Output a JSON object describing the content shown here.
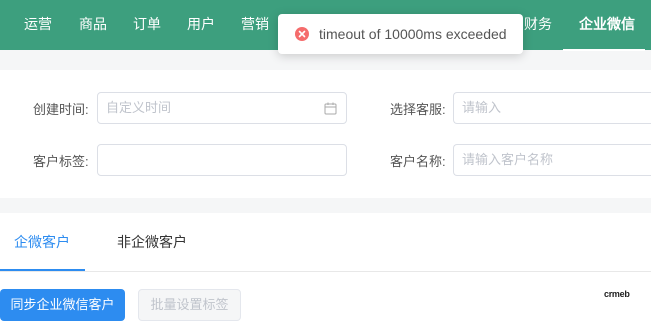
{
  "nav": {
    "items": [
      {
        "label": "运营",
        "key": "yunying"
      },
      {
        "label": "商品",
        "key": "shangpin"
      },
      {
        "label": "订单",
        "key": "dingdan"
      },
      {
        "label": "用户",
        "key": "yonghu"
      },
      {
        "label": "营销",
        "key": "yingxiao"
      },
      {
        "label": "财务",
        "key": "caiwu"
      },
      {
        "label": "企业微信",
        "key": "qiyeweixin",
        "active": true
      }
    ],
    "background": "#3d9f7e"
  },
  "toast": {
    "message": "timeout of 10000ms exceeded",
    "type": "error",
    "icon": "error-circle-icon",
    "color": "#f56c6c"
  },
  "filters": {
    "created_time": {
      "label": "创建时间:",
      "placeholder": "自定义时间",
      "icon": "calendar-icon"
    },
    "service_agent": {
      "label": "选择客服:",
      "placeholder": "请输入"
    },
    "customer_tag": {
      "label": "客户标签:",
      "value": ""
    },
    "customer_name": {
      "label": "客户名称:",
      "placeholder": "请输入客户名称"
    }
  },
  "tabs": [
    {
      "label": "企微客户",
      "active": true
    },
    {
      "label": "非企微客户",
      "active": false
    }
  ],
  "actions": {
    "sync_label": "同步企业微信客户",
    "batch_tag_label": "批量设置标签"
  },
  "brand": {
    "logo_text": "crmeb"
  },
  "colors": {
    "primary": "#2d8cf0",
    "nav": "#3d9f7e",
    "error": "#f56c6c"
  }
}
